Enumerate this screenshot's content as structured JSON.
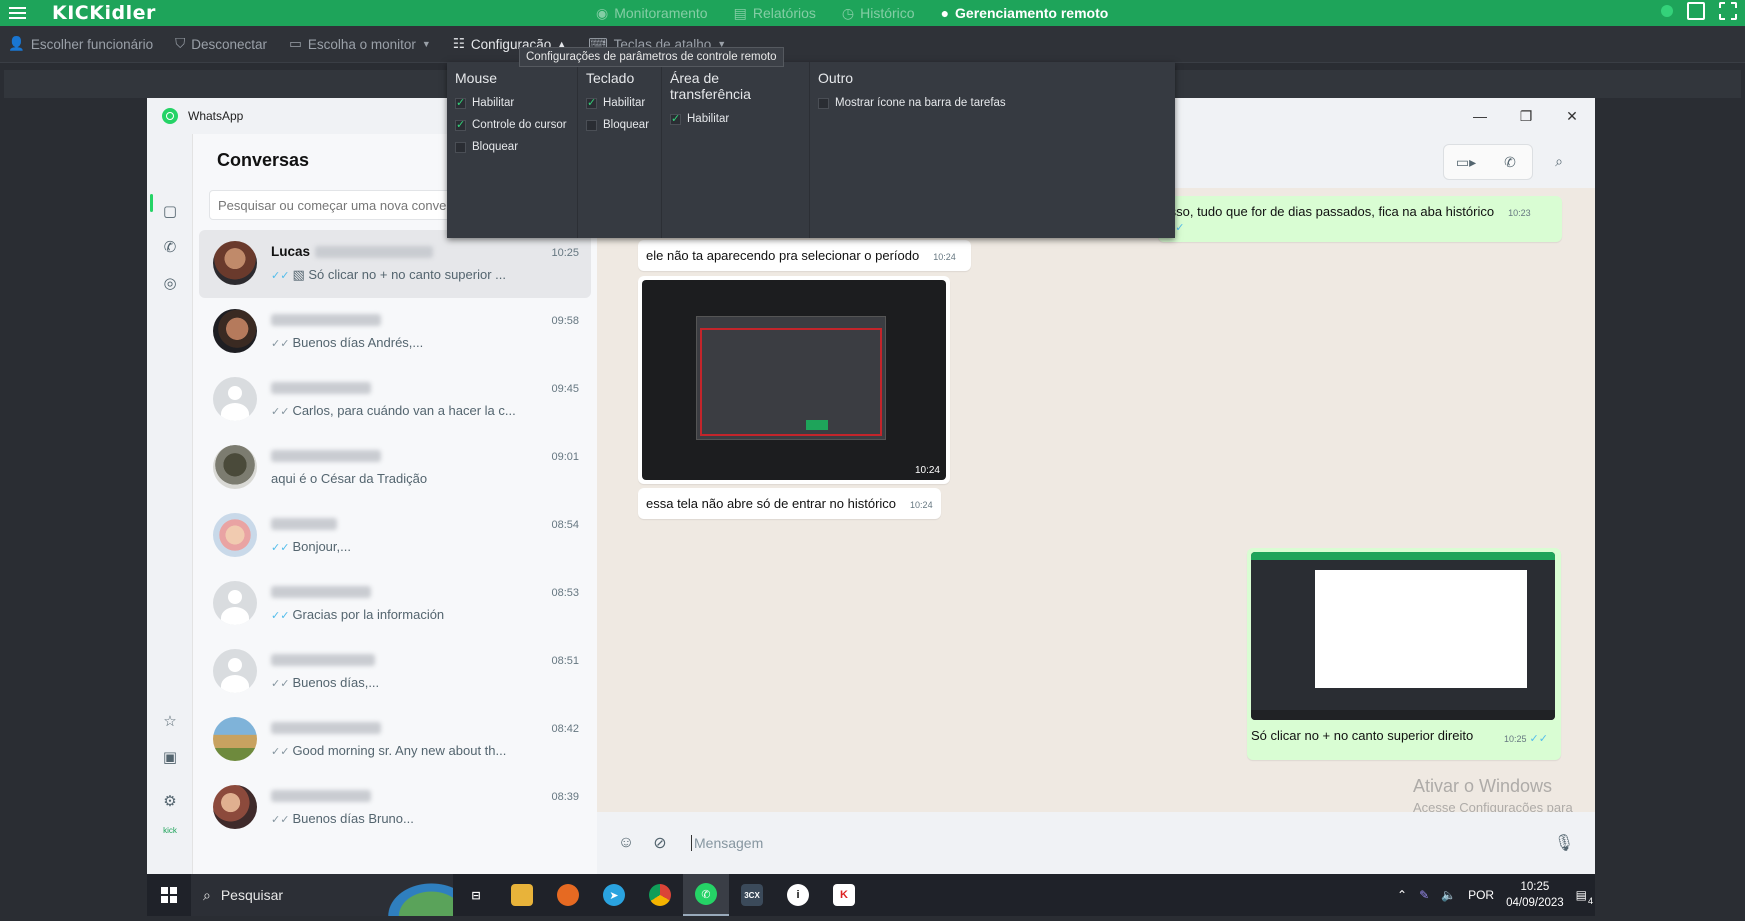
{
  "app": {
    "logo": "KICKidler",
    "top_tabs": [
      {
        "label": "Monitoramento",
        "icon": "eye-icon",
        "active": false
      },
      {
        "label": "Relatórios",
        "icon": "document-icon",
        "active": false
      },
      {
        "label": "Histórico",
        "icon": "history-icon",
        "active": false
      },
      {
        "label": "Gerenciamento remoto",
        "icon": "remote-icon",
        "active": true
      }
    ]
  },
  "toolbar": {
    "items": [
      {
        "label": "Escolher funcionário",
        "icon": "users-icon"
      },
      {
        "label": "Desconectar",
        "icon": "shield-icon"
      },
      {
        "label": "Escolha o monitor",
        "icon": "monitor-icon"
      },
      {
        "label": "Configuração",
        "icon": "sliders-icon"
      },
      {
        "label": "Teclas de atalho",
        "icon": "keyboard-icon"
      }
    ]
  },
  "tooltip": "Configurações de parâmetros de controle remoto",
  "config": {
    "columns": [
      {
        "title": "Mouse",
        "options": [
          {
            "label": "Habilitar",
            "checked": true
          },
          {
            "label": "Controle do cursor",
            "checked": true
          },
          {
            "label": "Bloquear",
            "checked": false
          }
        ]
      },
      {
        "title": "Teclado",
        "options": [
          {
            "label": "Habilitar",
            "checked": true
          },
          {
            "label": "Bloquear",
            "checked": false
          }
        ]
      },
      {
        "title": "Área de transferência",
        "options": [
          {
            "label": "Habilitar",
            "checked": true
          }
        ]
      },
      {
        "title": "Outro",
        "options": [
          {
            "label": "Mostrar ícone na barra de tarefas",
            "checked": false
          }
        ]
      }
    ]
  },
  "whatsapp": {
    "window_title": "WhatsApp",
    "chats_title": "Conversas",
    "search_placeholder": "Pesquisar ou começar uma nova conversa",
    "chats": [
      {
        "name": "Lucas",
        "time": "10:25",
        "message": "Só clicar no + no canto superior ...",
        "ticks": "blue",
        "photo": true
      },
      {
        "name": "",
        "time": "09:58",
        "message": "Buenos días Andrés,...",
        "ticks": "gray"
      },
      {
        "name": "",
        "time": "09:45",
        "message": "Carlos, para cuándo van a hacer la c...",
        "ticks": "gray"
      },
      {
        "name": "",
        "time": "09:01",
        "message": "aqui é o César da Tradição",
        "ticks": "none"
      },
      {
        "name": "",
        "time": "08:54",
        "message": "Bonjour,...",
        "ticks": "blue"
      },
      {
        "name": "",
        "time": "08:53",
        "message": "Gracias por la información",
        "ticks": "blue"
      },
      {
        "name": "",
        "time": "08:51",
        "message": "Buenos días,...",
        "ticks": "gray"
      },
      {
        "name": "",
        "time": "08:42",
        "message": "Good morning sr. Any new about th...",
        "ticks": "gray"
      },
      {
        "name": "",
        "time": "08:39",
        "message": "Buenos días Bruno...",
        "ticks": "gray"
      }
    ],
    "messages": [
      {
        "text": "Isso, tudo que for de dias passados, fica na aba histórico",
        "time": "10:23",
        "dir": "out"
      },
      {
        "text": "ele não ta aparecendo pra selecionar o período",
        "time": "10:24",
        "dir": "in"
      },
      {
        "text": "",
        "time": "10:24",
        "dir": "in",
        "image": true
      },
      {
        "text": "essa tela não abre só de entrar no histórico",
        "time": "10:24",
        "dir": "in"
      },
      {
        "text": "Só clicar no + no canto superior direito",
        "time": "10:25",
        "dir": "out",
        "image": true
      }
    ],
    "composer_placeholder": "Mensagem",
    "watermark_title": "Ativar o Windows",
    "watermark_sub": "Acesse Configurações para ativar o Windows."
  },
  "taskbar": {
    "search_label": "Pesquisar",
    "lang": "POR",
    "time": "10:25",
    "date": "04/09/2023",
    "notifications": "4"
  },
  "colors": {
    "kickidler_green": "#1ea45a",
    "wa_green": "#25d366",
    "out_bubble": "#d9fdd3"
  }
}
